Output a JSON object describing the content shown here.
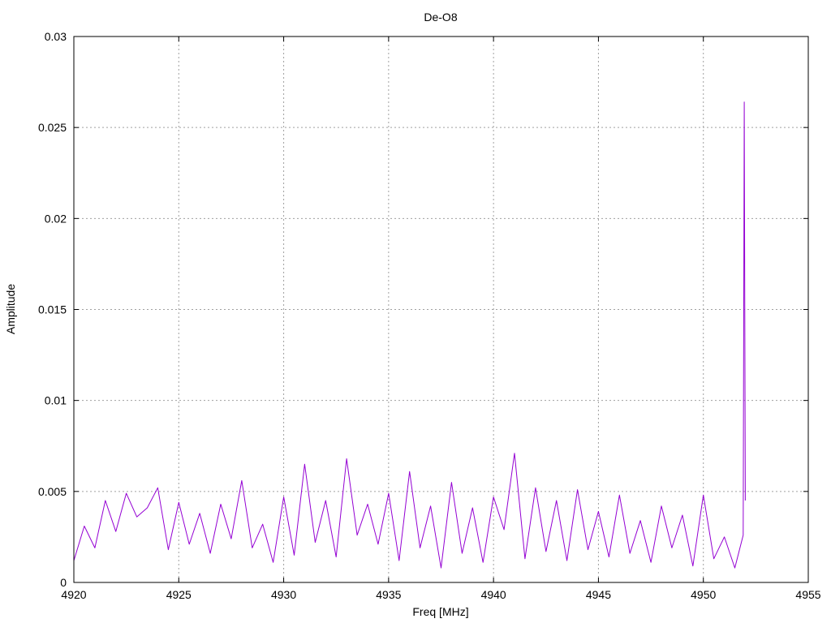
{
  "chart_data": {
    "type": "line",
    "title": "De-O8",
    "xlabel": "Freq [MHz]",
    "ylabel": "Amplitude",
    "xlim": [
      4920,
      4955
    ],
    "ylim": [
      0,
      0.03
    ],
    "x_ticks": [
      4920,
      4925,
      4930,
      4935,
      4940,
      4945,
      4950,
      4955
    ],
    "x_tick_labels": [
      "4920",
      "4925",
      "4930",
      "4935",
      "4940",
      "4945",
      "4950",
      "4955"
    ],
    "y_ticks": [
      0,
      0.005,
      0.01,
      0.015,
      0.02,
      0.025,
      0.03
    ],
    "y_tick_labels": [
      "0",
      "0.005",
      "0.01",
      "0.015",
      "0.02",
      "0.025",
      "0.03"
    ],
    "grid": true,
    "series": [
      {
        "color": "#9400d3",
        "x": [
          4920,
          4920.5,
          4921,
          4921.5,
          4922,
          4922.5,
          4923,
          4923.5,
          4924,
          4924.5,
          4925,
          4925.5,
          4926,
          4926.5,
          4927,
          4927.5,
          4928,
          4928.5,
          4929,
          4929.5,
          4930,
          4930.5,
          4931,
          4931.5,
          4932,
          4932.5,
          4933,
          4933.5,
          4934,
          4934.5,
          4935,
          4935.5,
          4936,
          4936.5,
          4937,
          4937.5,
          4938,
          4938.5,
          4939,
          4939.5,
          4940,
          4940.5,
          4941,
          4941.5,
          4942,
          4942.5,
          4943,
          4943.5,
          4944,
          4944.5,
          4945,
          4945.5,
          4946,
          4946.5,
          4947,
          4947.5,
          4948,
          4948.5,
          4949,
          4949.5,
          4950,
          4950.5,
          4951,
          4951.5,
          4951.9,
          4951.95,
          4952.0
        ],
        "y": [
          0.0012,
          0.0031,
          0.0019,
          0.0045,
          0.0028,
          0.0049,
          0.0036,
          0.0041,
          0.0052,
          0.0018,
          0.0044,
          0.0021,
          0.0038,
          0.0016,
          0.0043,
          0.0024,
          0.0056,
          0.0019,
          0.0032,
          0.0011,
          0.0047,
          0.0015,
          0.0065,
          0.0022,
          0.0045,
          0.0014,
          0.0068,
          0.0026,
          0.0043,
          0.0021,
          0.0049,
          0.0012,
          0.0061,
          0.0019,
          0.0042,
          0.0008,
          0.0055,
          0.0016,
          0.0041,
          0.0011,
          0.0047,
          0.0029,
          0.0071,
          0.0013,
          0.0052,
          0.0017,
          0.0045,
          0.0012,
          0.0051,
          0.0018,
          0.0039,
          0.0014,
          0.0048,
          0.0016,
          0.0034,
          0.0011,
          0.0042,
          0.0019,
          0.0037,
          0.0009,
          0.0048,
          0.0013,
          0.0025,
          0.0008,
          0.0026,
          0.0264,
          0.0045
        ]
      }
    ]
  }
}
